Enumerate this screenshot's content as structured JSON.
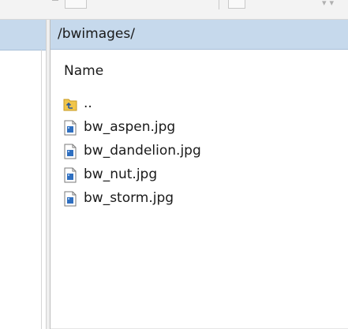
{
  "remote_pane": {
    "path": "/bwimages/",
    "column_header": "Name",
    "items": [
      {
        "label": "..",
        "icon": "parent-folder-icon"
      },
      {
        "label": "bw_aspen.jpg",
        "icon": "image-file-icon"
      },
      {
        "label": "bw_dandelion.jpg",
        "icon": "image-file-icon"
      },
      {
        "label": "bw_nut.jpg",
        "icon": "image-file-icon"
      },
      {
        "label": "bw_storm.jpg",
        "icon": "image-file-icon"
      }
    ]
  },
  "colors": {
    "path_bar_bg": "#c6d9ec",
    "folder_icon": "#f0c54a",
    "file_icon_blue": "#2f6fc0"
  }
}
